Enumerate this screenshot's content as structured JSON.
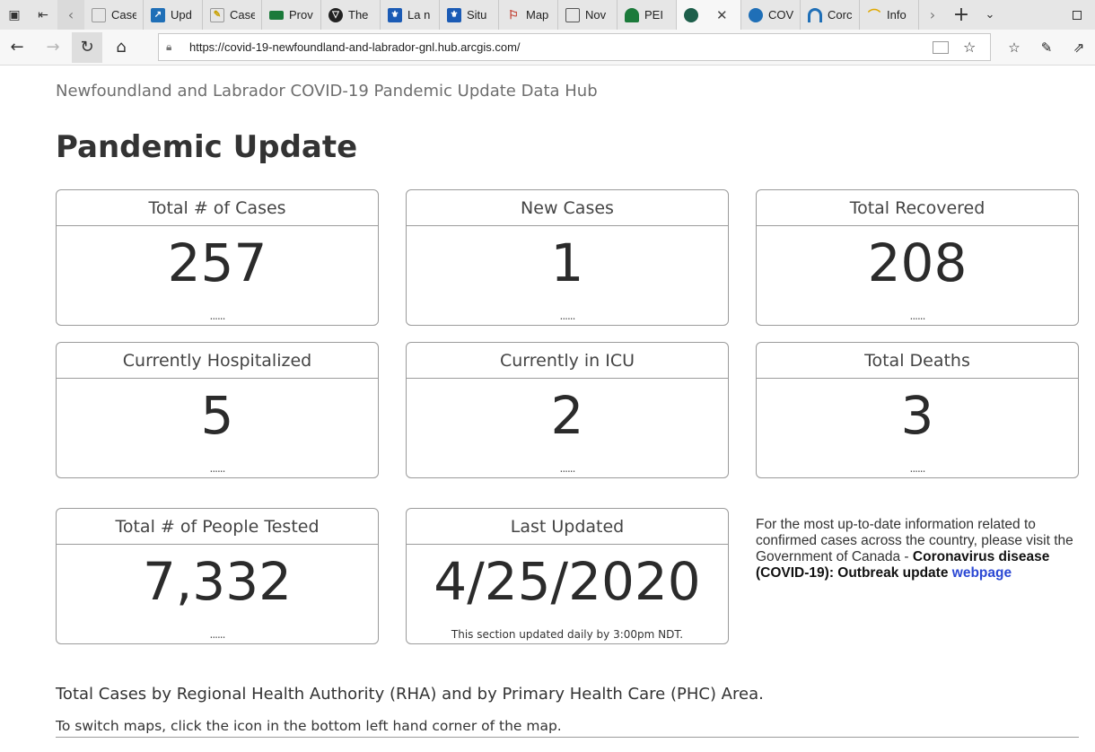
{
  "browser": {
    "tabs": [
      {
        "title": "Case",
        "icon": "document-icon",
        "color": "#ffffff"
      },
      {
        "title": "Upd",
        "icon": "chart-icon",
        "color": "#1f6fb7"
      },
      {
        "title": "Case",
        "icon": "pencil-document-icon",
        "color": "#c8a000"
      },
      {
        "title": "Prov",
        "icon": "green-flag-icon",
        "color": "#1b7a3a"
      },
      {
        "title": "The",
        "icon": "shield-icon",
        "color": "#222222"
      },
      {
        "title": "La n",
        "icon": "fleur-de-lis-icon",
        "color": "#1b5bb5"
      },
      {
        "title": "Situ",
        "icon": "fleur-de-lis-icon",
        "color": "#1b5bb5"
      },
      {
        "title": "Map",
        "icon": "map-pin-icon",
        "color": "#c0392b"
      },
      {
        "title": "Nov",
        "icon": "image-icon",
        "color": "#555555"
      },
      {
        "title": "PEI",
        "icon": "pei-icon",
        "color": "#1b7a3a"
      }
    ],
    "active_tab_icon": "globe-icon",
    "tabs_after": [
      {
        "title": "COV",
        "icon": "arc-icon",
        "color": "#1f6fb7"
      },
      {
        "title": "Corc",
        "icon": "arc-icon",
        "color": "#1f6fb7"
      },
      {
        "title": "Info",
        "icon": "wave-icon",
        "color": "#e0a800"
      }
    ],
    "url": "https://covid-19-newfoundland-and-labrador-gnl.hub.arcgis.com/"
  },
  "page": {
    "site_title": "Newfoundland and Labrador COVID-19 Pandemic Update Data Hub",
    "title": "Pandemic Update"
  },
  "cards": [
    {
      "label": "Total # of Cases",
      "value": "257",
      "footer": "......"
    },
    {
      "label": "New Cases",
      "value": "1",
      "footer": "......"
    },
    {
      "label": "Total Recovered",
      "value": "208",
      "footer": "......"
    },
    {
      "label": "Currently Hospitalized",
      "value": "5",
      "footer": "......"
    },
    {
      "label": "Currently in ICU",
      "value": "2",
      "footer": "......"
    },
    {
      "label": "Total Deaths",
      "value": "3",
      "footer": "......"
    },
    {
      "label": "Total # of People Tested",
      "value": "7,332",
      "footer": "......"
    },
    {
      "label": "Last Updated",
      "value": "4/25/2020",
      "footer": "This section updated daily by 3:00pm NDT."
    }
  ],
  "info": {
    "text": "For the most up-to-date information related to confirmed cases across the country, please visit the Government of Canada - ",
    "bold": "Coronavirus disease (COVID-19): Outbreak update",
    "link": "webpage"
  },
  "rha_text": "Total Cases by Regional Health Authority (RHA) and by Primary Health Care (PHC) Area.",
  "switch_text": "To switch maps, click the icon in the bottom left hand corner of the map."
}
